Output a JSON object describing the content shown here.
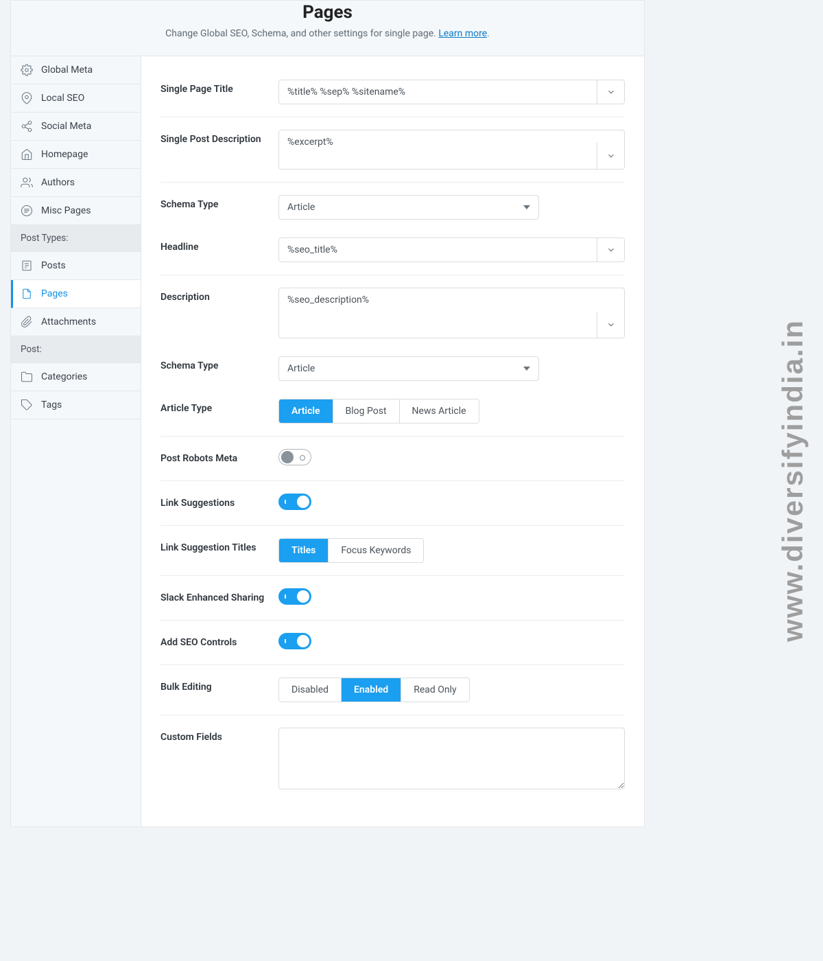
{
  "watermark": "www.diversifyindia.in",
  "hero": {
    "title": "Pages",
    "subtitle": "Change Global SEO, Schema, and other settings for single page.",
    "learn_more": "Learn more"
  },
  "sidebar": {
    "items_top": [
      {
        "label": "Global Meta",
        "icon": "gear"
      },
      {
        "label": "Local SEO",
        "icon": "pin"
      },
      {
        "label": "Social Meta",
        "icon": "share"
      },
      {
        "label": "Homepage",
        "icon": "home"
      },
      {
        "label": "Authors",
        "icon": "users"
      },
      {
        "label": "Misc Pages",
        "icon": "lines"
      }
    ],
    "header_post_types": "Post Types:",
    "items_post_types": [
      {
        "label": "Posts",
        "icon": "post"
      },
      {
        "label": "Pages",
        "icon": "page",
        "active": true
      },
      {
        "label": "Attachments",
        "icon": "clip"
      }
    ],
    "header_post": "Post:",
    "items_post": [
      {
        "label": "Categories",
        "icon": "folder"
      },
      {
        "label": "Tags",
        "icon": "tag"
      }
    ]
  },
  "form": {
    "single_page_title": {
      "label": "Single Page Title",
      "value": "%title% %sep% %sitename%"
    },
    "single_post_description": {
      "label": "Single Post Description",
      "value": "%excerpt%"
    },
    "schema_type_1": {
      "label": "Schema Type",
      "value": "Article"
    },
    "headline": {
      "label": "Headline",
      "value": "%seo_title%"
    },
    "description": {
      "label": "Description",
      "value": "%seo_description%"
    },
    "schema_type_2": {
      "label": "Schema Type",
      "value": "Article"
    },
    "article_type": {
      "label": "Article Type",
      "options": [
        "Article",
        "Blog Post",
        "News Article"
      ],
      "active": 0
    },
    "post_robots": {
      "label": "Post Robots Meta",
      "on": false
    },
    "link_suggestions": {
      "label": "Link Suggestions",
      "on": true
    },
    "link_suggestion_titles": {
      "label": "Link Suggestion Titles",
      "options": [
        "Titles",
        "Focus Keywords"
      ],
      "active": 0
    },
    "slack": {
      "label": "Slack Enhanced Sharing",
      "on": true
    },
    "seo_controls": {
      "label": "Add SEO Controls",
      "on": true
    },
    "bulk_editing": {
      "label": "Bulk Editing",
      "options": [
        "Disabled",
        "Enabled",
        "Read Only"
      ],
      "active": 1
    },
    "custom_fields": {
      "label": "Custom Fields",
      "value": ""
    }
  }
}
